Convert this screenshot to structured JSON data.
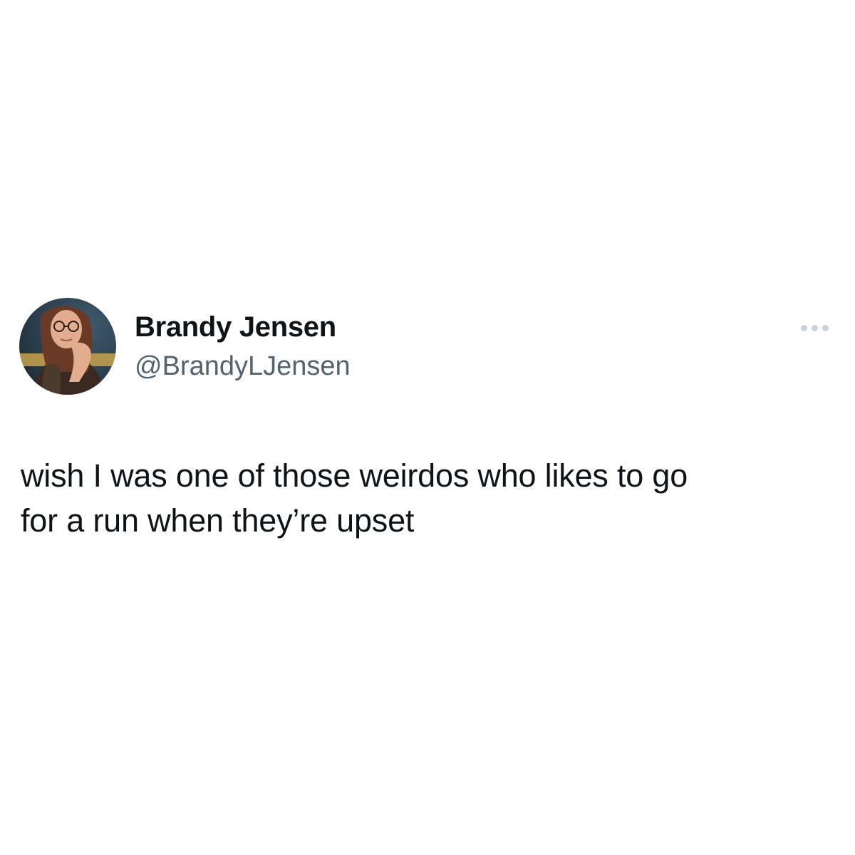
{
  "tweet": {
    "author": {
      "display_name": "Brandy Jensen",
      "handle": "@BrandyLJensen",
      "avatar_icon": "profile-photo"
    },
    "more_icon": "more-horizontal-icon",
    "text": "wish I was one of those weirdos who likes to go\nfor a run when they’re upset"
  },
  "colors": {
    "background": "#ffffff",
    "name": "#0f1419",
    "handle": "#536471",
    "more_dots": "#c9d3da"
  }
}
